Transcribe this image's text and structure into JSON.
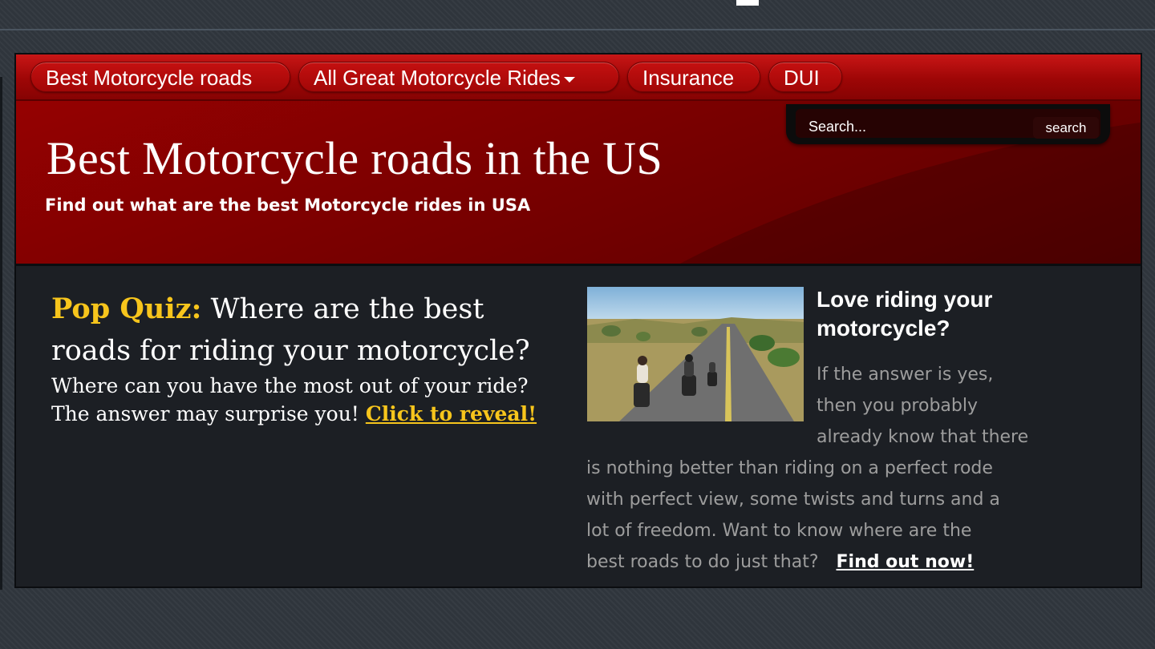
{
  "nav": {
    "items": [
      {
        "label": "Best Motorcycle roads"
      },
      {
        "label": "All Great Motorcycle Rides"
      },
      {
        "label": "Insurance"
      },
      {
        "label": "DUI"
      }
    ]
  },
  "search": {
    "placeholder": "Search...",
    "button_label": "search"
  },
  "header": {
    "title": "Best Motorcycle roads in the US",
    "tagline": "Find out what are the best Motorcycle rides in USA"
  },
  "quiz": {
    "highlight": "Pop Quiz:",
    "question": "Where are the best roads for riding your motorcycle?",
    "line1": "Where can you have the most out of your ride?",
    "line2": "The answer may surprise you!",
    "link": "Click to reveal!"
  },
  "promo": {
    "title": "Love riding your motorcycle?",
    "text_lines": [
      "If the answer is yes,",
      "then you probably",
      "already know that there"
    ],
    "text_rest": [
      "is nothing better than riding on a perfect rode",
      "with perfect view, some twists and turns and a",
      "lot of freedom. Want to know where are the",
      "best roads to do just that?"
    ],
    "link": "Find out now!"
  },
  "colors": {
    "nav_red": "#b50b0b",
    "header_red": "#8a0000",
    "quiz_yellow": "#f7c51c",
    "body_bg": "#1c1f24"
  }
}
